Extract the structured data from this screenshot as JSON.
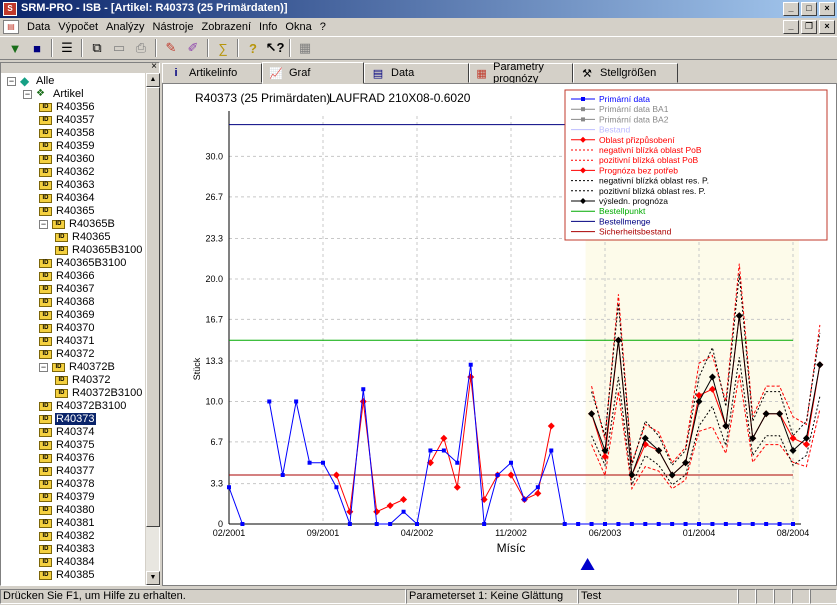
{
  "window": {
    "title": "SRM-PRO - ISB - [Artikel: R40373 (25 Primärdaten)]",
    "app_icon": "srm-app-icon"
  },
  "menu": [
    "Data",
    "Výpočet",
    "Analýzy",
    "Nástroje",
    "Zobrazení",
    "Info",
    "Okna",
    "?"
  ],
  "toolbar": {
    "buttons": [
      "filter-icon",
      "save-icon",
      "list-icon",
      "copy-icon",
      "paste-icon",
      "print-icon",
      "calc-icon",
      "calc-all-icon",
      "sum-icon",
      "help-icon",
      "context-help-icon",
      "calendar-icon"
    ]
  },
  "tree": {
    "root": "Alle",
    "nodes": [
      {
        "label": "Artikel",
        "level": 1,
        "type": "folder"
      },
      {
        "label": "R40356",
        "level": 2,
        "type": "item"
      },
      {
        "label": "R40357",
        "level": 2,
        "type": "item"
      },
      {
        "label": "R40358",
        "level": 2,
        "type": "item"
      },
      {
        "label": "R40359",
        "level": 2,
        "type": "item"
      },
      {
        "label": "R40360",
        "level": 2,
        "type": "item"
      },
      {
        "label": "R40362",
        "level": 2,
        "type": "item"
      },
      {
        "label": "R40363",
        "level": 2,
        "type": "item"
      },
      {
        "label": "R40364",
        "level": 2,
        "type": "item"
      },
      {
        "label": "R40365",
        "level": 2,
        "type": "item"
      },
      {
        "label": "R40365B",
        "level": 2,
        "type": "group"
      },
      {
        "label": "R40365",
        "level": 3,
        "type": "item"
      },
      {
        "label": "R40365B3100",
        "level": 3,
        "type": "item"
      },
      {
        "label": "R40365B3100",
        "level": 2,
        "type": "item"
      },
      {
        "label": "R40366",
        "level": 2,
        "type": "item"
      },
      {
        "label": "R40367",
        "level": 2,
        "type": "item"
      },
      {
        "label": "R40368",
        "level": 2,
        "type": "item"
      },
      {
        "label": "R40369",
        "level": 2,
        "type": "item"
      },
      {
        "label": "R40370",
        "level": 2,
        "type": "item"
      },
      {
        "label": "R40371",
        "level": 2,
        "type": "item"
      },
      {
        "label": "R40372",
        "level": 2,
        "type": "item"
      },
      {
        "label": "R40372B",
        "level": 2,
        "type": "group"
      },
      {
        "label": "R40372",
        "level": 3,
        "type": "item"
      },
      {
        "label": "R40372B3100",
        "level": 3,
        "type": "item"
      },
      {
        "label": "R40372B3100",
        "level": 2,
        "type": "item"
      },
      {
        "label": "R40373",
        "level": 2,
        "type": "item",
        "selected": true
      },
      {
        "label": "R40374",
        "level": 2,
        "type": "item"
      },
      {
        "label": "R40375",
        "level": 2,
        "type": "item"
      },
      {
        "label": "R40376",
        "level": 2,
        "type": "item"
      },
      {
        "label": "R40377",
        "level": 2,
        "type": "item"
      },
      {
        "label": "R40378",
        "level": 2,
        "type": "item"
      },
      {
        "label": "R40379",
        "level": 2,
        "type": "item"
      },
      {
        "label": "R40380",
        "level": 2,
        "type": "item"
      },
      {
        "label": "R40381",
        "level": 2,
        "type": "item"
      },
      {
        "label": "R40382",
        "level": 2,
        "type": "item"
      },
      {
        "label": "R40383",
        "level": 2,
        "type": "item"
      },
      {
        "label": "R40384",
        "level": 2,
        "type": "item"
      },
      {
        "label": "R40385",
        "level": 2,
        "type": "item"
      }
    ]
  },
  "tabs": [
    {
      "label": "Artikelinfo",
      "icon": "info-icon",
      "active": false
    },
    {
      "label": "Graf",
      "icon": "chart-icon",
      "active": true
    },
    {
      "label": "Data",
      "icon": "table-icon",
      "active": false
    },
    {
      "label": "Parametry prognózy",
      "icon": "params-icon",
      "active": false
    },
    {
      "label": "Stellgrößen",
      "icon": "hammer-icon",
      "active": false
    }
  ],
  "chart_data": {
    "type": "line",
    "title": "R40373 (25 Primärdaten)",
    "subtitle": "LAUFRAD 210X08-0.6020",
    "xlabel": "Mísíc",
    "ylabel": "Stück",
    "ylim": [
      0,
      33.3
    ],
    "yticks": [
      "0",
      "3.3",
      "6.7",
      "10.0",
      "13.3",
      "16.7",
      "20.0",
      "23.3",
      "26.7",
      "30.0"
    ],
    "ytick_values": [
      0,
      3.3,
      6.7,
      10.0,
      13.3,
      16.7,
      20.0,
      23.3,
      26.7,
      30.0
    ],
    "xticks": [
      "02/2001",
      "09/2001",
      "04/2002",
      "11/2002",
      "06/2003",
      "01/2004",
      "08/2004"
    ],
    "xtick_index": [
      0,
      7,
      14,
      21,
      28,
      35,
      42
    ],
    "forecast_start_index": 27,
    "colors": {
      "primary": "#0000ff",
      "fitted": "#ff0000",
      "final": "#000000",
      "bestellpunkt": "#00aa00",
      "bestellmenge": "#000080",
      "sicherheit": "#aa0000",
      "forecast_bg": "#fdfbea"
    },
    "series": [
      {
        "name": "Primární data",
        "values": [
          3,
          0,
          null,
          10,
          4,
          10,
          5,
          5,
          3,
          0,
          11,
          0,
          0,
          1,
          0,
          6,
          6,
          5,
          13,
          0,
          4,
          5,
          2,
          3,
          6,
          0,
          0,
          0,
          0,
          0,
          0,
          0,
          0,
          0,
          0,
          0,
          0,
          0,
          0,
          0,
          0,
          0,
          0
        ]
      },
      {
        "name": "Oblast přizpůsobení",
        "values": [
          null,
          null,
          null,
          null,
          null,
          null,
          null,
          null,
          4,
          1,
          10,
          1,
          1.5,
          2,
          null,
          5,
          7,
          3,
          12,
          2,
          4,
          4,
          2,
          2.5,
          8,
          null,
          null,
          null,
          null,
          null,
          null,
          null,
          null,
          null,
          null,
          null,
          null,
          null,
          null,
          null,
          null,
          null,
          null
        ]
      },
      {
        "name": "výsledn. prognóza",
        "values": [
          null,
          null,
          null,
          null,
          null,
          null,
          null,
          null,
          null,
          null,
          null,
          null,
          null,
          null,
          null,
          null,
          null,
          null,
          null,
          null,
          null,
          null,
          null,
          null,
          null,
          null,
          null,
          9,
          6,
          15,
          4,
          7,
          6,
          4,
          5,
          10,
          12,
          8,
          17,
          7,
          9,
          9,
          6,
          7,
          13
        ]
      },
      {
        "name": "Prognóza bez potřeb",
        "values": [
          null,
          null,
          null,
          null,
          null,
          null,
          null,
          null,
          null,
          null,
          null,
          null,
          null,
          null,
          null,
          null,
          null,
          null,
          null,
          null,
          null,
          null,
          null,
          null,
          null,
          null,
          null,
          9,
          5.5,
          15,
          4,
          6.5,
          6,
          4,
          5,
          10.5,
          11,
          8,
          17,
          7,
          9,
          9,
          7,
          6.5,
          13
        ]
      }
    ],
    "legend": [
      {
        "label": "Primární data",
        "color": "#0000ff",
        "style": "solid",
        "marker": "square"
      },
      {
        "label": "Primární data BA1",
        "color": "#888888",
        "style": "solid",
        "marker": "square"
      },
      {
        "label": "Primární data BA2",
        "color": "#888888",
        "style": "solid",
        "marker": "square"
      },
      {
        "label": "Bestand",
        "color": "#bbbbff",
        "style": "solid",
        "marker": "none"
      },
      {
        "label": "Oblast přizpůsobení",
        "color": "#ff0000",
        "style": "solid",
        "marker": "diamond"
      },
      {
        "label": "negativní blízká oblast PoB",
        "color": "#ff0000",
        "style": "dashed",
        "marker": "none"
      },
      {
        "label": "pozitivní blízká oblast PoB",
        "color": "#ff0000",
        "style": "dashed",
        "marker": "none"
      },
      {
        "label": "Prognóza bez potřeb",
        "color": "#ff0000",
        "style": "solid",
        "marker": "diamond"
      },
      {
        "label": "negativní blízká oblast res. P.",
        "color": "#000000",
        "style": "dashed",
        "marker": "none"
      },
      {
        "label": "pozitivní blízká oblast res. P.",
        "color": "#000000",
        "style": "dashed",
        "marker": "none"
      },
      {
        "label": "výsledn. prognóza",
        "color": "#000000",
        "style": "solid",
        "marker": "diamond"
      },
      {
        "label": "Bestellpunkt",
        "color": "#00aa00",
        "style": "solid",
        "marker": "none"
      },
      {
        "label": "Bestellmenge",
        "color": "#000080",
        "style": "solid",
        "marker": "none"
      },
      {
        "label": "Sicherheitsbestand",
        "color": "#aa0000",
        "style": "solid",
        "marker": "none"
      }
    ],
    "hlines": [
      {
        "name": "Bestellmenge",
        "value": 32.6,
        "color": "#000080"
      },
      {
        "name": "Bestellpunkt",
        "value": 15.0,
        "color": "#00aa00"
      },
      {
        "name": "Sicherheitsbestand",
        "value": 4.0,
        "color": "#aa0000"
      }
    ],
    "grid": true,
    "legend_position": "top-right"
  },
  "status": {
    "help": "Drücken Sie F1, um Hilfe zu erhalten.",
    "param": "Parameterset 1: Keine Glättung",
    "mode": "Test"
  }
}
